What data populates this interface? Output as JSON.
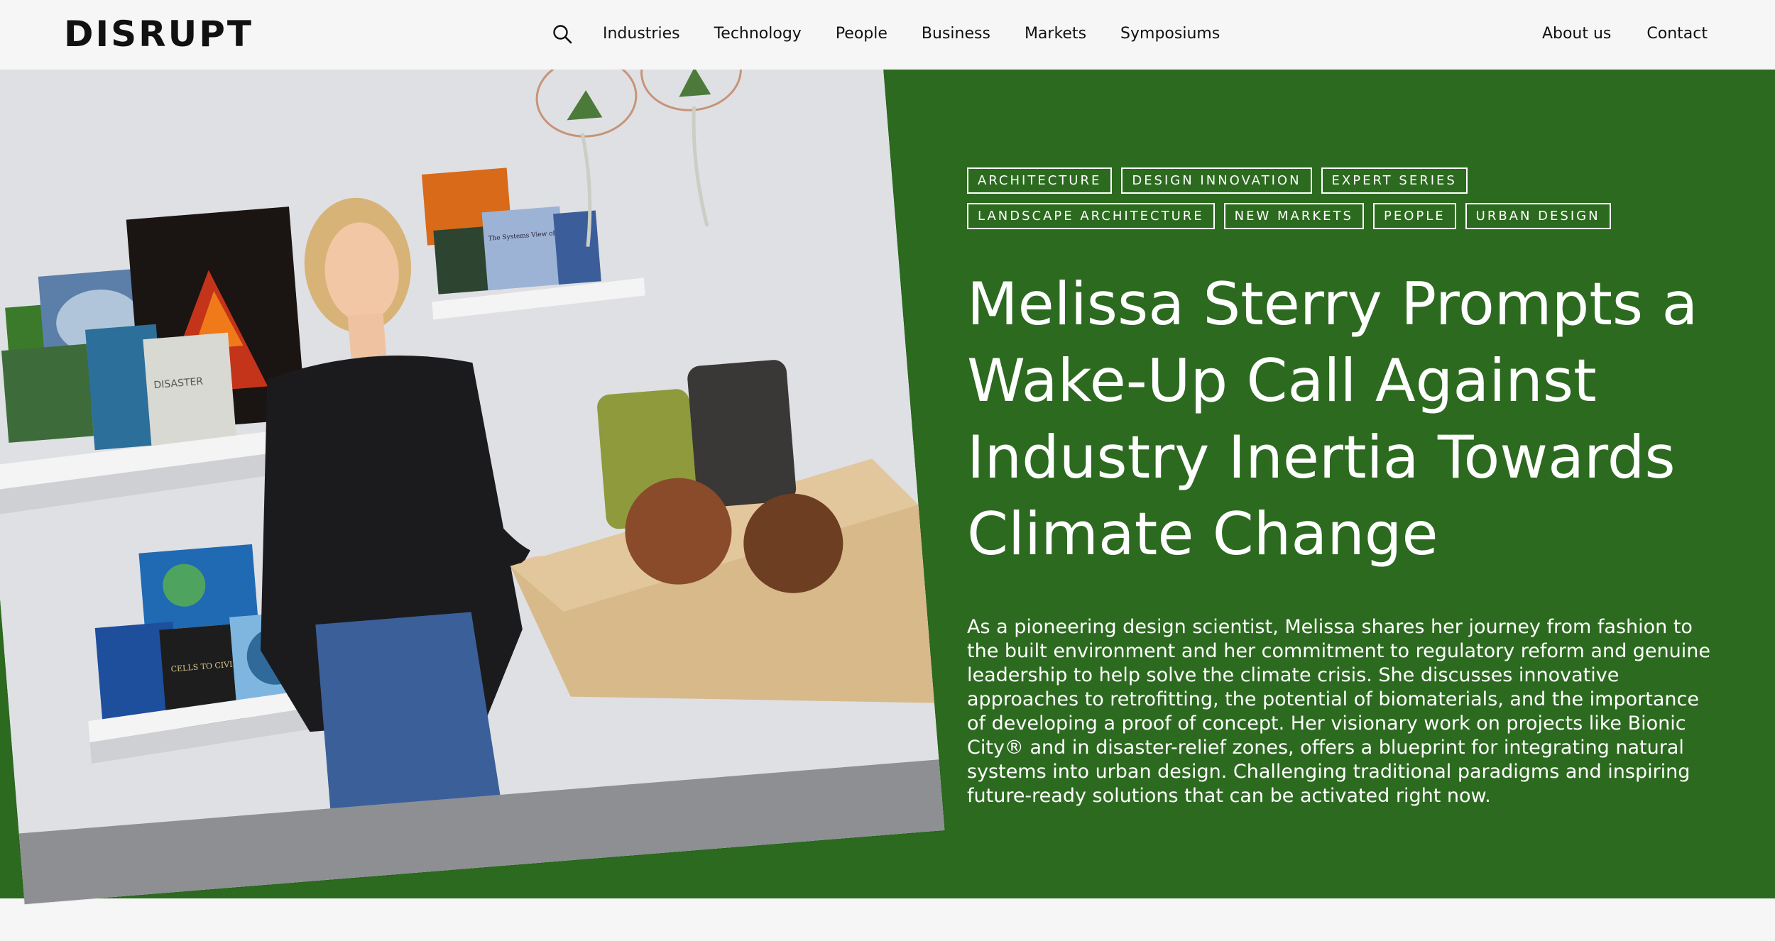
{
  "header": {
    "logo_text": "DISRUPT",
    "search_icon": "search-icon",
    "nav": [
      {
        "label": "Industries"
      },
      {
        "label": "Technology"
      },
      {
        "label": "People"
      },
      {
        "label": "Business"
      },
      {
        "label": "Markets"
      },
      {
        "label": "Symposiums"
      }
    ],
    "secondary_nav": [
      {
        "label": "About us"
      },
      {
        "label": "Contact"
      }
    ]
  },
  "hero": {
    "background_color": "#2c6a1f",
    "tags": [
      {
        "label": "ARCHITECTURE"
      },
      {
        "label": "DESIGN INNOVATION"
      },
      {
        "label": "EXPERT SERIES"
      },
      {
        "label": "LANDSCAPE ARCHITECTURE"
      },
      {
        "label": "NEW MARKETS"
      },
      {
        "label": "PEOPLE"
      },
      {
        "label": "URBAN DESIGN"
      }
    ],
    "title": "Melissa Sterry Prompts a Wake-Up Call Against Industry Inertia Towards Climate Change",
    "summary": "As a pioneering design scientist, Melissa shares her journey from fashion to the built environment and her commitment to regulatory reform and genuine leadership to help solve the climate crisis. She discusses innovative approaches to retrofitting, the potential of biomaterials, and the importance of developing a proof of concept. Her visionary work on projects like Bionic City® and in disaster-relief zones, offers a blueprint for integrating natural systems into urban design. Challenging traditional paradigms and inspiring future-ready solutions that can be activated right now.",
    "photo": {
      "book_labels": {
        "disaster": "DISASTER",
        "cells": "CELLS TO CIVILIZATIONS",
        "systems": "The Systems View of Life"
      }
    }
  }
}
